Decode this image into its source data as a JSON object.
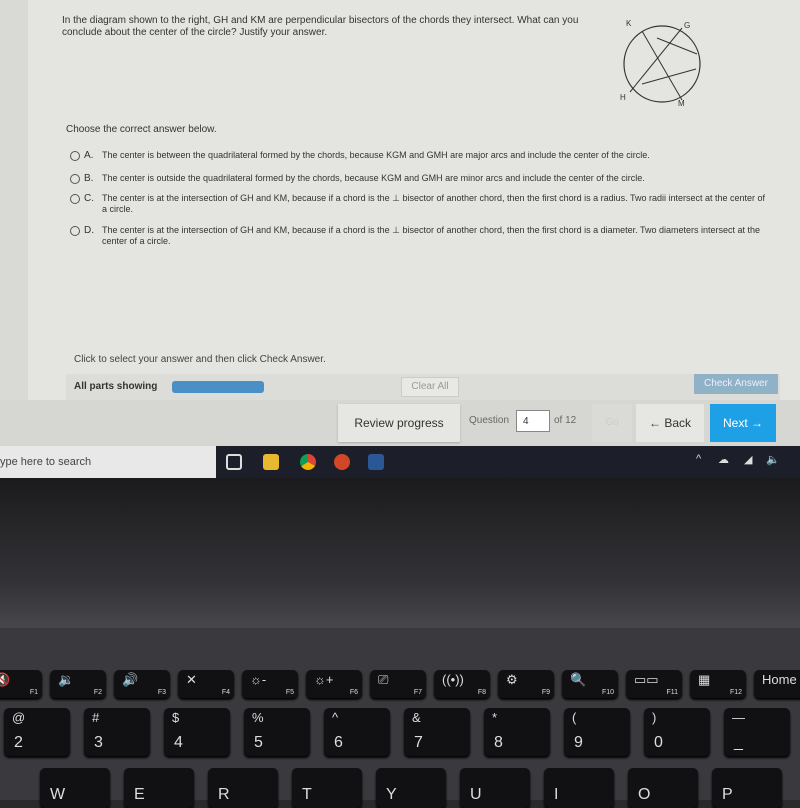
{
  "question": {
    "text": "In the diagram shown to the right, GH and KM are perpendicular bisectors of the chords they intersect. What can you conclude about the center of the circle? Justify your answer.",
    "diagram_labels": {
      "k": "K",
      "g": "G",
      "h": "H",
      "m": "M"
    }
  },
  "choose_label": "Choose the correct answer below.",
  "options": [
    {
      "letter": "A.",
      "text": "The center is between the quadrilateral formed by the chords, because KGM and GMH are major arcs and include the center of the circle."
    },
    {
      "letter": "B.",
      "text": "The center is outside the quadrilateral formed by the chords, because KGM and GMH are minor arcs and include the center of the circle."
    },
    {
      "letter": "C.",
      "text": "The center is at the intersection of GH and KM, because if a chord is the ⊥ bisector of another chord, then the first chord is a radius. Two radii intersect at the center of a circle."
    },
    {
      "letter": "D.",
      "text": "The center is at the intersection of GH and KM, because if a chord is the ⊥ bisector of another chord, then the first chord is a diameter. Two diameters intersect at the center of a circle."
    }
  ],
  "hint": "Click to select your answer and then click Check Answer.",
  "bar": {
    "parts_label": "All parts showing",
    "progress": 1.0,
    "clear_all": "Clear All",
    "check_answer": "Check Answer"
  },
  "nav": {
    "review": "Review progress",
    "question_label": "Question",
    "question_value": "4",
    "of_label": "of 12",
    "go": "Go",
    "back": "← Back",
    "next": "Next →"
  },
  "taskbar": {
    "search_placeholder": "ype here to search"
  },
  "keyboard": {
    "fkeys": [
      {
        "l": "🔇",
        "f": "F1"
      },
      {
        "l": "🔉",
        "f": "F2"
      },
      {
        "l": "🔊",
        "f": "F3"
      },
      {
        "l": "✕",
        "f": "F4"
      },
      {
        "l": "☼-",
        "f": "F5"
      },
      {
        "l": "☼+",
        "f": "F6"
      },
      {
        "l": "⎚",
        "f": "F7"
      },
      {
        "l": "((•))",
        "f": "F8"
      },
      {
        "l": "⚙",
        "f": "F9"
      },
      {
        "l": "🔍",
        "f": "F10"
      },
      {
        "l": "▭▭",
        "f": "F11"
      },
      {
        "l": "▦",
        "f": "F12"
      },
      {
        "l": "Home",
        "f": ""
      }
    ],
    "numbers": [
      {
        "t": "@",
        "b": "2"
      },
      {
        "t": "#",
        "b": "3"
      },
      {
        "t": "$",
        "b": "4"
      },
      {
        "t": "%",
        "b": "5"
      },
      {
        "t": "^",
        "b": "6"
      },
      {
        "t": "&",
        "b": "7"
      },
      {
        "t": "*",
        "b": "8"
      },
      {
        "t": "(",
        "b": "9"
      },
      {
        "t": ")",
        "b": "0"
      },
      {
        "t": "—",
        "b": "_"
      }
    ],
    "letters": [
      "W",
      "E",
      "R",
      "T",
      "Y",
      "U",
      "I",
      "O",
      "P"
    ]
  },
  "colors": {
    "next": "#1ea0e6",
    "progress": "#4a8fc6",
    "check": "#8fb2c6"
  }
}
